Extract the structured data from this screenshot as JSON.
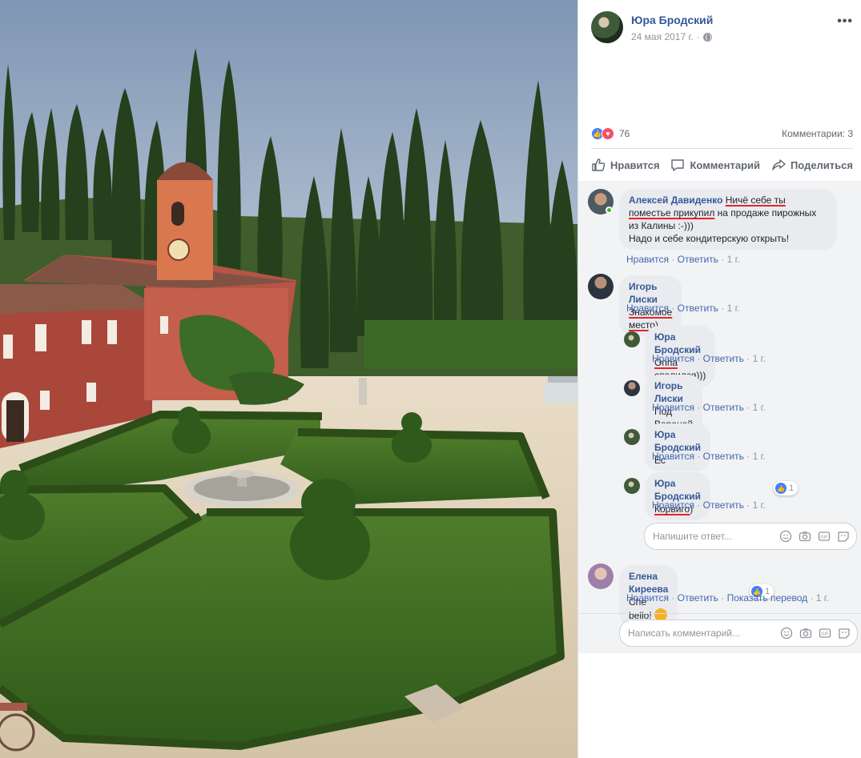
{
  "post": {
    "author": "Юра Бродский",
    "date": "24 мая 2017 г.",
    "privacy_icon": "globe-icon",
    "more_icon": "more-icon"
  },
  "reactions": {
    "count": "76",
    "comments_label": "Комментарии: 3",
    "types": [
      "like-icon",
      "love-icon"
    ]
  },
  "actions": {
    "like": "Нравится",
    "comment": "Комментарий",
    "share": "Поделиться"
  },
  "comments": [
    {
      "author": "Алексей Давиденко",
      "text_underlined": "Ничё себе ты поместье прикупил",
      "text_rest_line": " на продаже пирожных из Калины :-)))",
      "text_line2": "Надо и себе кондитерскую открыть!",
      "like": "Нравится",
      "reply": "Ответить",
      "time": "1 г.",
      "replies": []
    },
    {
      "author": "Игорь Лиски",
      "text_underlined": "Знакомое место",
      "text_rest": ")",
      "like": "Нравится",
      "reply": "Ответить",
      "time": "1 г.",
      "replies": [
        {
          "author": "Юра Бродский",
          "text_underlined": "Оппа спалился",
          "text_rest": ")))",
          "like": "Нравится",
          "reply": "Ответить",
          "time": "1 г."
        },
        {
          "author": "Игорь Лиски",
          "text_underlined": "",
          "text_rest": "Под Вероной ...)",
          "like": "Нравится",
          "reply": "Ответить",
          "time": "1 г."
        },
        {
          "author": "Юра Бродский",
          "text_underlined": "",
          "text_rest": "Ес",
          "like": "Нравится",
          "reply": "Ответить",
          "time": "1 г."
        },
        {
          "author": "Юра Бродский",
          "text_underlined": "Корвиго",
          "text_rest": ")",
          "like": "Нравится",
          "reply": "Ответить",
          "time": "1 г.",
          "reaction_count": "1"
        }
      ],
      "reply_placeholder": "Напишите ответ..."
    },
    {
      "author": "Елена Киреева",
      "text_underlined": "",
      "text_rest": "Che bello!",
      "like": "Нравится",
      "reply": "Ответить",
      "translate": "Показать перевод",
      "time": "1 г.",
      "reaction_count": "1"
    }
  ],
  "comment_input": {
    "placeholder": "Написать комментарий..."
  },
  "colors": {
    "link_blue": "#365899",
    "meta_gray": "#90949c",
    "underline_red": "#e3242b",
    "like_blue": "#4080ff",
    "love_red": "#f25268"
  }
}
